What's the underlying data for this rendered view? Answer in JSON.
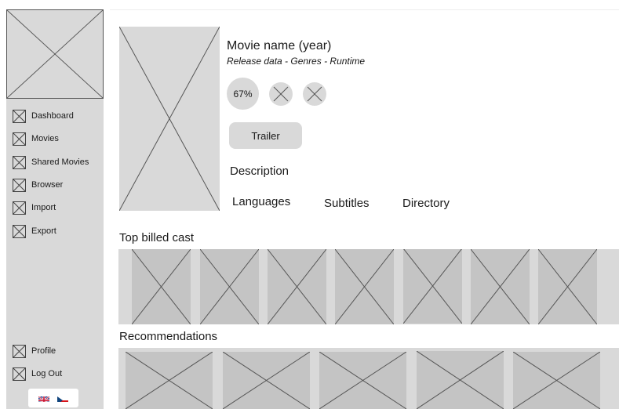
{
  "sidebar": {
    "nav": [
      {
        "label": "Dashboard",
        "icon": "placeholder-icon"
      },
      {
        "label": "Movies",
        "icon": "placeholder-icon"
      },
      {
        "label": "Shared Movies",
        "icon": "placeholder-icon"
      },
      {
        "label": "Browser",
        "icon": "placeholder-icon"
      },
      {
        "label": "Import",
        "icon": "placeholder-icon"
      },
      {
        "label": "Export",
        "icon": "placeholder-icon"
      }
    ],
    "bottom": [
      {
        "label": "Profile",
        "icon": "placeholder-icon"
      },
      {
        "label": "Log Out",
        "icon": "placeholder-icon"
      }
    ],
    "languages": [
      "uk-flag-icon",
      "czech-flag-icon"
    ]
  },
  "movie": {
    "title": "Movie name (year)",
    "subtitle": "Release data - Genres - Runtime",
    "score": "67%",
    "trailer_label": "Trailer",
    "description_label": "Description",
    "languages_label": "Languages",
    "subtitles_label": "Subtitles",
    "directory_label": "Directory"
  },
  "sections": {
    "cast_title": "Top billed cast",
    "recommendations_title": "Recommendations"
  },
  "colors": {
    "placeholder": "#d9d9d9",
    "tile": "#c4c4c4",
    "line": "#555555"
  }
}
